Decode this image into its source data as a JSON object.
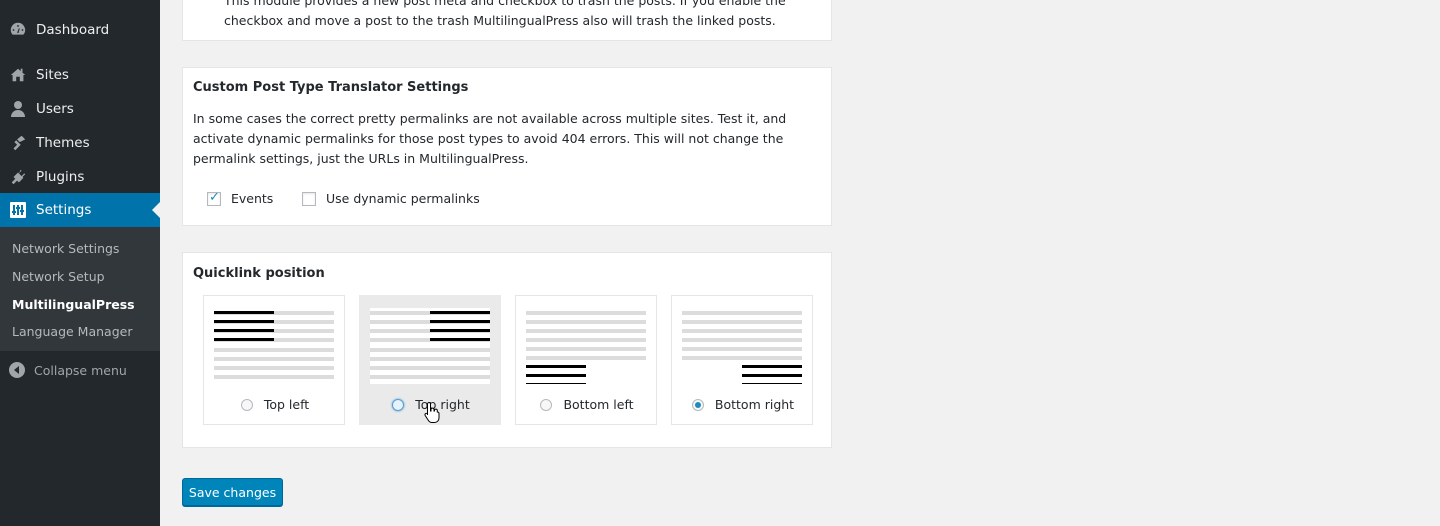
{
  "sidebar": {
    "items": [
      {
        "label": "Dashboard",
        "icon": "dashboard-icon"
      },
      {
        "label": "Sites",
        "icon": "sites-icon"
      },
      {
        "label": "Users",
        "icon": "users-icon"
      },
      {
        "label": "Themes",
        "icon": "themes-icon"
      },
      {
        "label": "Plugins",
        "icon": "plugins-icon"
      },
      {
        "label": "Settings",
        "icon": "settings-icon"
      }
    ],
    "submenu": [
      "Network Settings",
      "Network Setup",
      "MultilingualPress",
      "Language Manager"
    ],
    "current_submenu": "MultilingualPress",
    "collapse_label": "Collapse menu"
  },
  "trash_panel": {
    "text": "This module provides a new post meta and checkbox to trash the posts. If you enable the checkbox and move a post to the trash MultilingualPress also will trash the linked posts."
  },
  "cpt_panel": {
    "title": "Custom Post Type Translator Settings",
    "description": "In some cases the correct pretty permalinks are not available across multiple sites. Test it, and activate dynamic permalinks for those post types to avoid 404 errors. This will not change the permalink settings, just the URLs in MultilingualPress.",
    "checkboxes": [
      {
        "label": "Events",
        "checked": true
      },
      {
        "label": "Use dynamic permalinks",
        "checked": false
      }
    ]
  },
  "quicklink_panel": {
    "title": "Quicklink position",
    "options": [
      {
        "label": "Top left",
        "selected": false
      },
      {
        "label": "Top right",
        "selected": false
      },
      {
        "label": "Bottom left",
        "selected": false
      },
      {
        "label": "Bottom right",
        "selected": true
      }
    ]
  },
  "save_button": "Save changes",
  "colors": {
    "sidebar_bg": "#23282d",
    "active_menu": "#0073aa",
    "button_primary": "#0085ba"
  }
}
